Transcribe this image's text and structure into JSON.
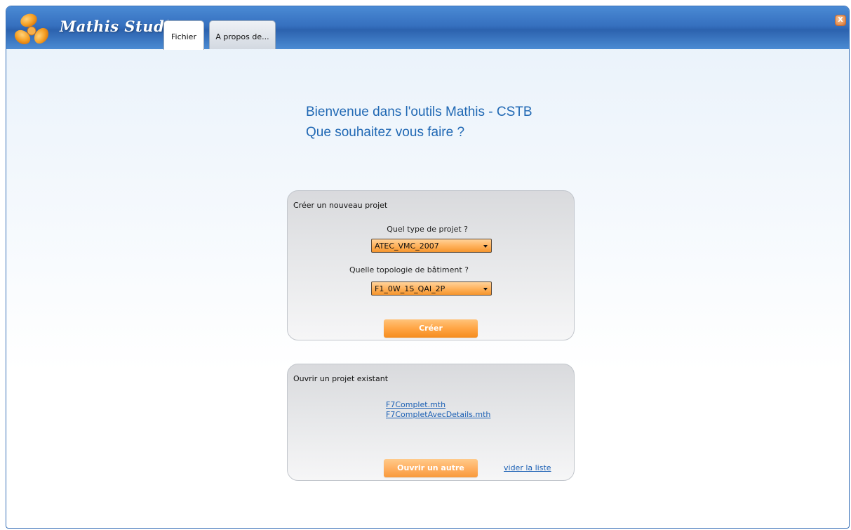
{
  "app": {
    "title": "Mathis Studio",
    "close_label": "X"
  },
  "tabs": [
    {
      "label": "Fichier",
      "active": true
    },
    {
      "label": "A propos de...",
      "active": false
    }
  ],
  "welcome": {
    "line1": "Bienvenue dans l'outils Mathis - CSTB",
    "line2": "Que souhaitez vous faire ?"
  },
  "create_panel": {
    "title": "Créer un nouveau projet",
    "type_label": "Quel type de projet ?",
    "type_value": "ATEC_VMC_2007",
    "topology_label": "Quelle topologie de bâtiment ?",
    "topology_value": "F1_0W_1S_QAI_2P",
    "create_button": "Créer"
  },
  "open_panel": {
    "title": "Ouvrir un projet existant",
    "recent_files": [
      "F7Complet.mth",
      "F7CompletAvecDetails.mth"
    ],
    "open_other_button": "Ouvrir un autre projet",
    "clear_list_link": "vider la liste"
  },
  "colors": {
    "titlebar": "#3670bf",
    "accent_orange": "#ffa544",
    "welcome_text": "#2068b4",
    "link": "#1a5fb4"
  }
}
